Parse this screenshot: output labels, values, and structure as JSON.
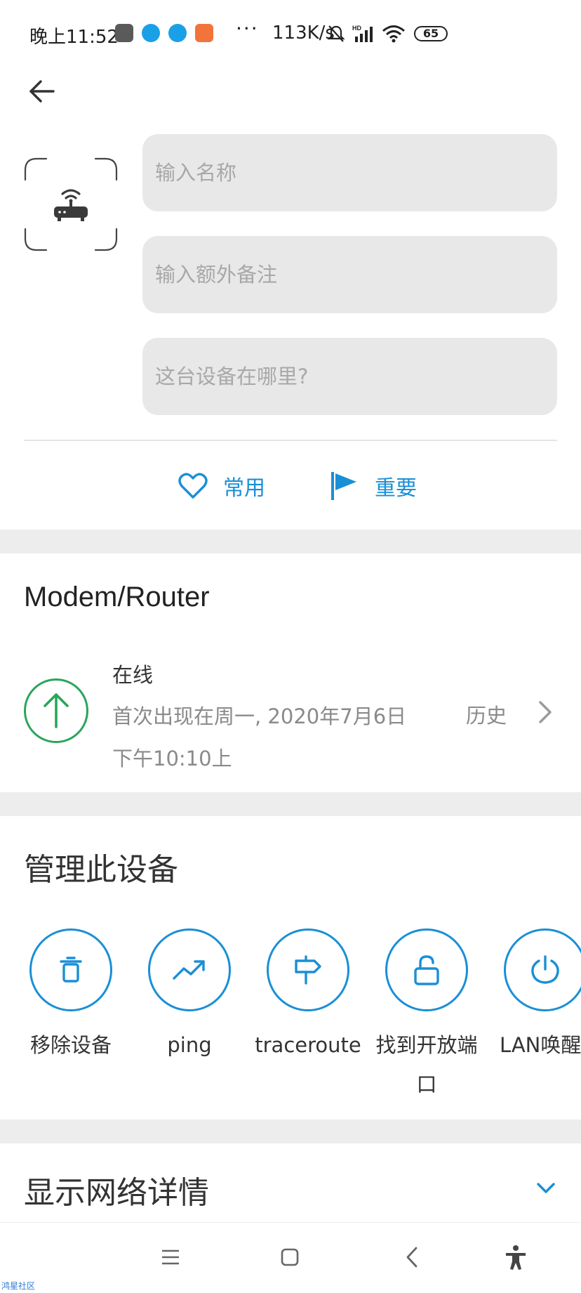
{
  "status_bar": {
    "time": "晚上11:52",
    "more": "···",
    "speed": "113K/s",
    "battery": "65",
    "icons": [
      "mi-app-icon",
      "blue-bubble-icon",
      "blue-bubble-icon",
      "mi-orange-icon",
      "mute-bell-icon",
      "hd-signal-icon",
      "wifi-icon",
      "battery-icon"
    ]
  },
  "header": {
    "back_icon": "arrow-left-icon"
  },
  "form": {
    "name_placeholder": "输入名称",
    "note_placeholder": "输入额外备注",
    "location_placeholder": "这台设备在哪里?"
  },
  "tags": {
    "common": "常用",
    "important": "重要"
  },
  "device": {
    "title": "Modem/Router",
    "status": "在线",
    "first_seen": "首次出现在周一, 2020年7月6日 下午10:10上",
    "history": "历史"
  },
  "manage": {
    "title": "管理此设备",
    "actions": [
      {
        "label": "移除设备",
        "icon": "trash-icon"
      },
      {
        "label": "ping",
        "icon": "trend-up-icon"
      },
      {
        "label": "traceroute",
        "icon": "signpost-icon"
      },
      {
        "label": "找到开放端口",
        "icon": "unlock-icon"
      },
      {
        "label": "LAN唤醒",
        "icon": "power-icon"
      }
    ]
  },
  "details": {
    "title": "显示网络详情"
  },
  "nav": {
    "icons": [
      "menu-icon",
      "home-square-icon",
      "back-chevron-icon",
      "accessibility-icon"
    ]
  },
  "watermark": "鸿星社区",
  "colors": {
    "accent": "#1a8fd6",
    "online": "#2aa55a",
    "field_bg": "#e8e8e8",
    "page_bg": "#ededed"
  }
}
